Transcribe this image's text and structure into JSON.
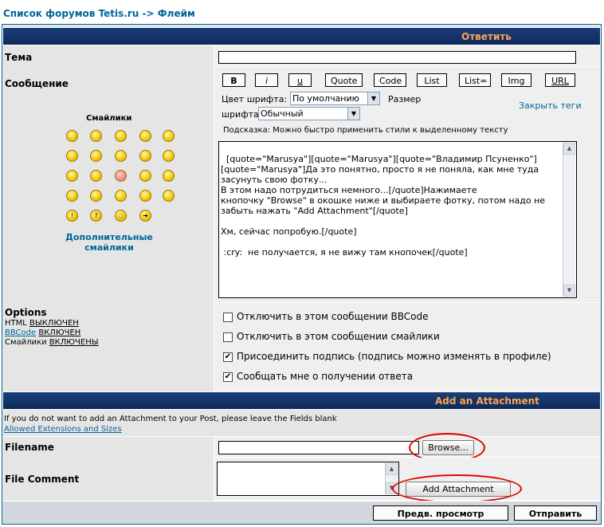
{
  "breadcrumb": {
    "home": "Список форумов Tetis.ru",
    "sep": "->",
    "forum": "Флейм"
  },
  "header": {
    "title": "Ответить"
  },
  "subject": {
    "label": "Тема",
    "value": ""
  },
  "message": {
    "label": "Сообщение",
    "bbcode_buttons": [
      "B",
      "i",
      "u",
      "Quote",
      "Code",
      "List",
      "List=",
      "Img",
      "URL"
    ],
    "color_label": "Цвет шрифта:",
    "color_value": "По умолчанию",
    "size_label_1": "Размер",
    "size_label_2": "шрифта:",
    "size_value": "Обычный",
    "close_tags": "Закрыть теги",
    "hint": "Подсказка: Можно быстро применить стили к выделенному тексту",
    "body": "[quote=\"Marusya\"][quote=\"Marusya\"][quote=\"Владимир Псуненко\"]\n[quote=\"Marusya\"]Да это понятно, просто я не поняла, как мне туда\nзасунуть свою фотку...\nВ этом надо потрудиться немного...[/quote]Нажимаете\nкнопочку \"Browse\" в окошке ниже и выбираете фотку, потом надо не\nзабыть нажать \"Add Attachment\"[/quote]\n\nХм, сейчас попробую.[/quote]\n\n :cry:  не получается, я не вижу там кнопочек[/quote]"
  },
  "smilies": {
    "title": "Смайлики",
    "more_1": "Дополнительные",
    "more_2": "смайлики"
  },
  "options": {
    "title": "Options",
    "html_label": "HTML",
    "html_state": "ВЫКЛЮЧЕН",
    "bbcode_label": "BBCode",
    "bbcode_state": "ВКЛЮЧЕН",
    "smilies_label": "Смайлики",
    "smilies_state": "ВКЛЮЧЕНЫ",
    "checkboxes": [
      {
        "label": "Отключить в этом сообщении BBCode",
        "checked": false
      },
      {
        "label": "Отключить в этом сообщении смайлики",
        "checked": false
      },
      {
        "label": "Присоединить подпись (подпись можно изменять в профиле)",
        "checked": true
      },
      {
        "label": "Сообщать мне о получении ответа",
        "checked": true
      }
    ]
  },
  "attachment": {
    "title": "Add an Attachment",
    "info": "If you do not want to add an Attachment to your Post, please leave the Fields blank",
    "allowed_link": "Allowed Extensions and Sizes",
    "filename_label": "Filename",
    "browse_button": "Browse...",
    "comment_label": "File Comment",
    "add_button": "Add Attachment"
  },
  "footer": {
    "preview_button": "Предв. просмотр",
    "submit_button": "Отправить"
  },
  "colors": {
    "header_bg": "#0e2a5a",
    "header_text": "#ffa34f",
    "link": "#006699",
    "highlight": "#e00000"
  }
}
